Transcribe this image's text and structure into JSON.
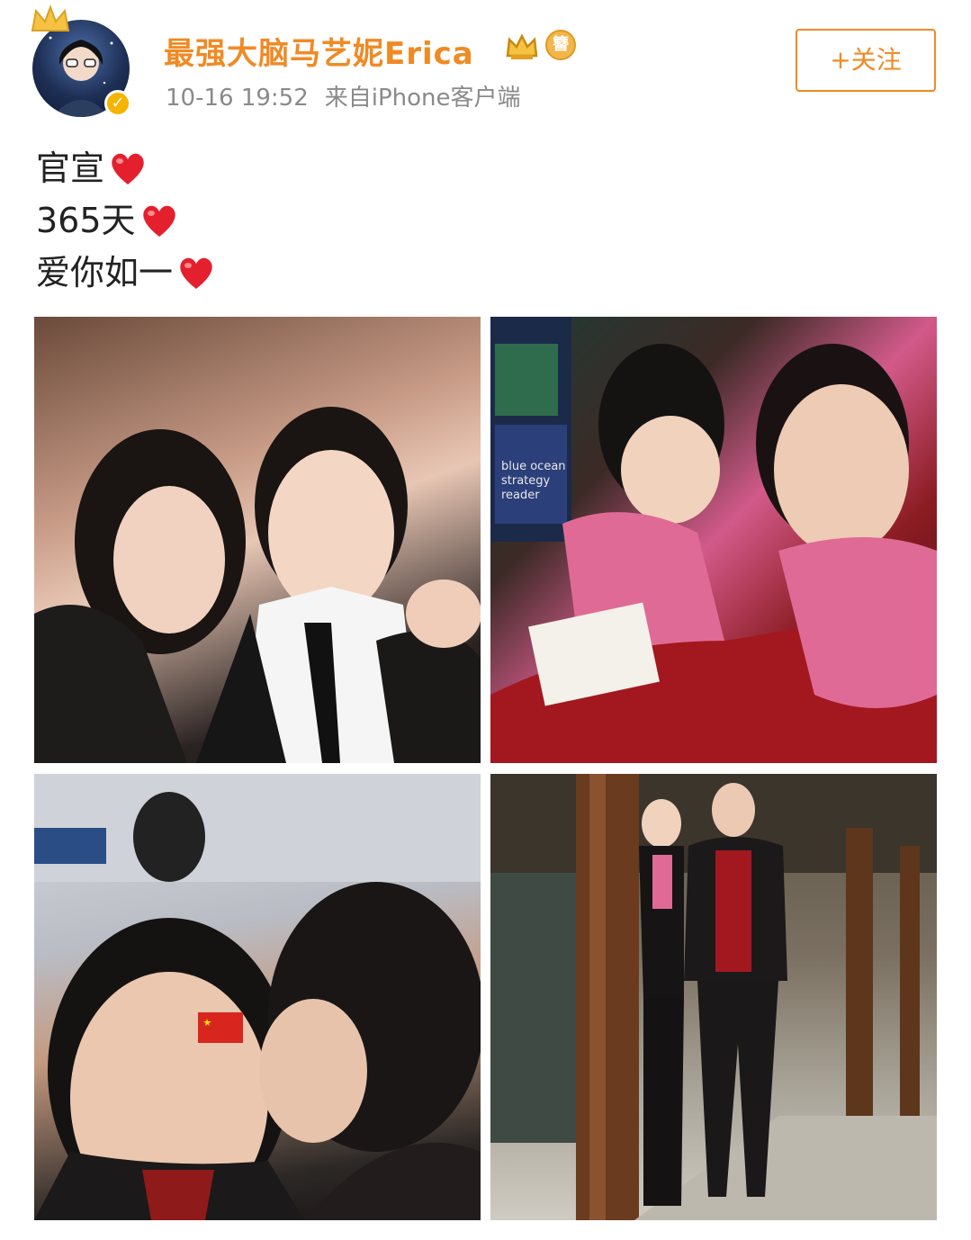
{
  "post": {
    "username": "最强大脑马艺妮Erica",
    "timestamp": "10-16 19:52",
    "source": "来自iPhone客户端",
    "follow_label": "+关注",
    "verified_mark": "✓",
    "level_badge": "簪",
    "lines": [
      "官宣",
      "365天",
      "爱你如一"
    ],
    "emoji": "red-heart"
  },
  "colors": {
    "username": "#f08a24",
    "follow_border": "#f08a24",
    "meta": "#8a8a8a",
    "heart": "#e5202e"
  },
  "photos": [
    {
      "alt": "couple selfie in dark setting"
    },
    {
      "alt": "couple reading at bookstore"
    },
    {
      "alt": "kiss on cheek with flag sticker on train"
    },
    {
      "alt": "couple standing by wooden pillar outdoors"
    }
  ],
  "photo_text": {
    "book": "blue ocean strategy reader"
  }
}
